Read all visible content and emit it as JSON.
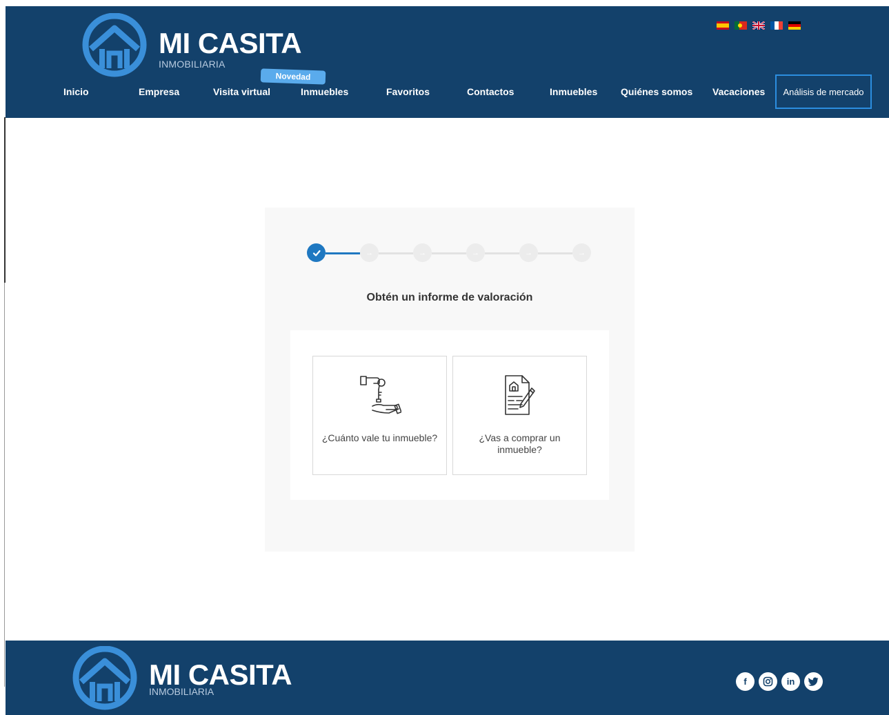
{
  "brand": {
    "name": "MI CASITA",
    "subtitle": "INMOBILIARIA"
  },
  "header": {
    "languages": [
      "es",
      "pt",
      "gb",
      "fr",
      "de"
    ],
    "badge": "Novedad",
    "nav": [
      {
        "label": "Inicio"
      },
      {
        "label": "Empresa"
      },
      {
        "label": "Visita virtual"
      },
      {
        "label": "Inmuebles"
      },
      {
        "label": "Favoritos"
      },
      {
        "label": "Contactos"
      },
      {
        "label": "Inmuebles"
      },
      {
        "label": "Quiénes somos"
      },
      {
        "label": "Vacaciones"
      },
      {
        "label": "Análisis de mercado"
      }
    ]
  },
  "wizard": {
    "steps_total": 6,
    "steps_completed": 1,
    "title": "Obtén un informe de valoración",
    "options": [
      {
        "label": "¿Cuánto vale tu inmueble?",
        "icon": "hand-key-icon"
      },
      {
        "label": "¿Vas a comprar un inmueble?",
        "icon": "document-pen-icon"
      }
    ]
  },
  "footer": {
    "socials": [
      "facebook-icon",
      "instagram-icon",
      "linkedin-icon",
      "twitter-icon"
    ]
  },
  "colors": {
    "header_bg": "#13416b",
    "accent": "#1f78c1",
    "badge": "#5aabec"
  }
}
